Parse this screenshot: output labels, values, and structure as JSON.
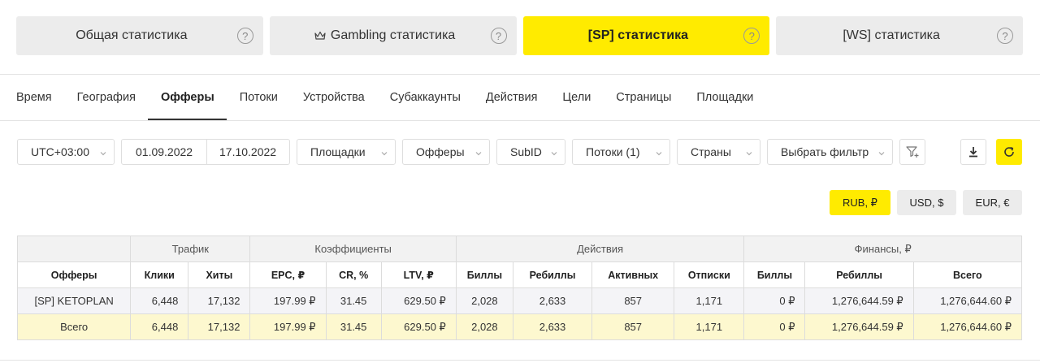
{
  "stat_tabs": [
    {
      "label": "Общая статистика",
      "icon": "",
      "active": false
    },
    {
      "label": "Gambling статистика",
      "icon": "crown-icon",
      "active": false
    },
    {
      "label": "[SP] статистика",
      "icon": "",
      "active": true
    },
    {
      "label": "[WS] статистика",
      "icon": "",
      "active": false
    }
  ],
  "help_glyph": "?",
  "sub_nav": [
    "Время",
    "География",
    "Офферы",
    "Потоки",
    "Устройства",
    "Субаккаунты",
    "Действия",
    "Цели",
    "Страницы",
    "Площадки"
  ],
  "sub_nav_active": "Офферы",
  "filters": {
    "timezone": "UTC+03:00",
    "date_from": "01.09.2022",
    "date_to": "17.10.2022",
    "platforms": "Площадки",
    "offers": "Офферы",
    "subid": "SubID",
    "streams": "Потоки (1)",
    "countries": "Страны",
    "choose_filter": "Выбрать фильтр"
  },
  "currencies": [
    {
      "label": "RUB, ₽",
      "active": true
    },
    {
      "label": "USD, $",
      "active": false
    },
    {
      "label": "EUR, €",
      "active": false
    }
  ],
  "table": {
    "groups": {
      "traffic": "Трафик",
      "coefficients": "Коэффициенты",
      "actions": "Действия",
      "finance": "Финансы, ₽"
    },
    "columns": [
      "Офферы",
      "Клики",
      "Хиты",
      "EPC, ₽",
      "CR, %",
      "LTV, ₽",
      "Биллы",
      "Ребиллы",
      "Активных",
      "Отписки",
      "Биллы",
      "Ребиллы",
      "Всего"
    ],
    "rows": [
      [
        "[SP] KETOPLAN",
        "6,448",
        "17,132",
        "197.99 ₽",
        "31.45",
        "629.50 ₽",
        "2,028",
        "2,633",
        "857",
        "1,171",
        "0 ₽",
        "1,276,644.59 ₽",
        "1,276,644.60 ₽"
      ],
      [
        "Всего",
        "6,448",
        "17,132",
        "197.99 ₽",
        "31.45",
        "629.50 ₽",
        "2,028",
        "2,633",
        "857",
        "1,171",
        "0 ₽",
        "1,276,644.59 ₽",
        "1,276,644.60 ₽"
      ]
    ]
  },
  "colors": {
    "accent": "#ffeb00",
    "tab_inactive": "#ececec",
    "total_row": "#fdf8cf"
  }
}
